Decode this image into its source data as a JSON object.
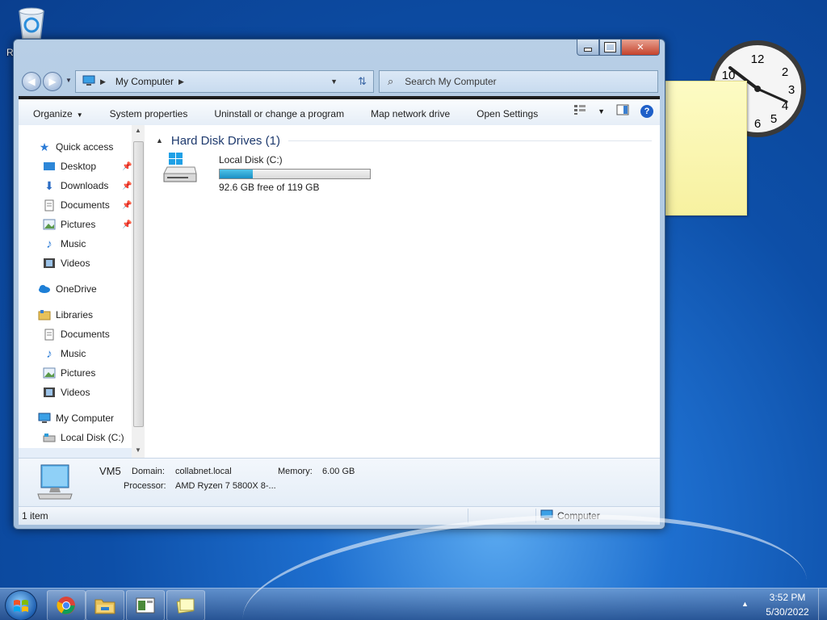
{
  "desktop": {
    "recycle_label": "R"
  },
  "clock": {
    "numbers": [
      "12",
      "2",
      "3",
      "4",
      "5",
      "6",
      "10"
    ]
  },
  "window": {
    "address": {
      "crumb": "My Computer"
    },
    "search": {
      "placeholder": "Search My Computer"
    },
    "toolbar": {
      "organize": "Organize",
      "system_properties": "System properties",
      "uninstall": "Uninstall or change a program",
      "map_drive": "Map network drive",
      "open_settings": "Open Settings"
    },
    "nav": {
      "quick_access": "Quick access",
      "desktop": "Desktop",
      "downloads": "Downloads",
      "documents": "Documents",
      "pictures": "Pictures",
      "music": "Music",
      "videos": "Videos",
      "onedrive": "OneDrive",
      "libraries": "Libraries",
      "lib_documents": "Documents",
      "lib_music": "Music",
      "lib_pictures": "Pictures",
      "lib_videos": "Videos",
      "my_computer": "My Computer",
      "local_disk": "Local Disk (C:)"
    },
    "content": {
      "group_header": "Hard Disk Drives (1)",
      "drive": {
        "name": "Local Disk (C:)",
        "free_text": "92.6 GB free of 119 GB",
        "used_fraction": 0.222
      }
    },
    "details": {
      "name": "VM5",
      "domain_label": "Domain:",
      "domain_value": "collabnet.local",
      "memory_label": "Memory:",
      "memory_value": "6.00 GB",
      "processor_label": "Processor:",
      "processor_value": "AMD Ryzen 7 5800X 8-..."
    },
    "status": {
      "count": "1 item",
      "location": "Computer"
    }
  },
  "taskbar": {
    "time": "3:52 PM",
    "date": "5/30/2022"
  },
  "colors": {
    "accent": "#1e5fc8",
    "drive_fill": "#1a8fc4"
  }
}
